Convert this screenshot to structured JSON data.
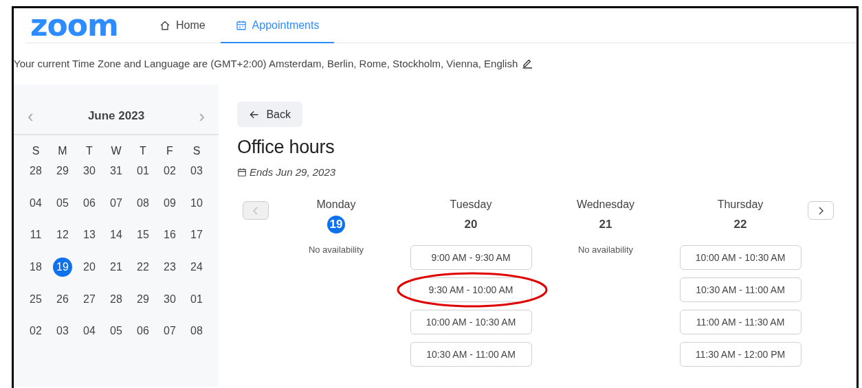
{
  "logo": "zoom",
  "nav": [
    {
      "label": "Home",
      "kind": "home",
      "selected": false
    },
    {
      "label": "Appointments",
      "kind": "calendar",
      "selected": true
    }
  ],
  "timezone_text": "Your current Time Zone and Language are (GMT+2:00) Amsterdam, Berlin, Rome, Stockholm, Vienna, English",
  "calendar": {
    "month": "June 2023",
    "prev": "‹",
    "next": "›",
    "weekdays": [
      "S",
      "M",
      "T",
      "W",
      "T",
      "F",
      "S"
    ],
    "weeks": [
      [
        {
          "day": "28",
          "selected": false
        },
        {
          "day": "29",
          "selected": false
        },
        {
          "day": "30",
          "selected": false
        },
        {
          "day": "31",
          "selected": false
        },
        {
          "day": "01",
          "selected": false
        },
        {
          "day": "02",
          "selected": false
        },
        {
          "day": "03",
          "selected": false
        }
      ],
      [
        {
          "day": "04",
          "selected": false
        },
        {
          "day": "05",
          "selected": false
        },
        {
          "day": "06",
          "selected": false
        },
        {
          "day": "07",
          "selected": false
        },
        {
          "day": "08",
          "selected": false
        },
        {
          "day": "09",
          "selected": false
        },
        {
          "day": "10",
          "selected": false
        }
      ],
      [
        {
          "day": "11",
          "selected": false
        },
        {
          "day": "12",
          "selected": false
        },
        {
          "day": "13",
          "selected": false
        },
        {
          "day": "14",
          "selected": false
        },
        {
          "day": "15",
          "selected": false
        },
        {
          "day": "16",
          "selected": false
        },
        {
          "day": "17",
          "selected": false
        }
      ],
      [
        {
          "day": "18",
          "selected": false
        },
        {
          "day": "19",
          "selected": true
        },
        {
          "day": "20",
          "selected": false
        },
        {
          "day": "21",
          "selected": false
        },
        {
          "day": "22",
          "selected": false
        },
        {
          "day": "23",
          "selected": false
        },
        {
          "day": "24",
          "selected": false
        }
      ],
      [
        {
          "day": "25",
          "selected": false
        },
        {
          "day": "26",
          "selected": false
        },
        {
          "day": "27",
          "selected": false
        },
        {
          "day": "28",
          "selected": false
        },
        {
          "day": "29",
          "selected": false
        },
        {
          "day": "30",
          "selected": false
        },
        {
          "day": "01",
          "selected": false
        }
      ],
      [
        {
          "day": "02",
          "selected": false
        },
        {
          "day": "03",
          "selected": false
        },
        {
          "day": "04",
          "selected": false
        },
        {
          "day": "05",
          "selected": false
        },
        {
          "day": "06",
          "selected": false
        },
        {
          "day": "07",
          "selected": false
        },
        {
          "day": "08",
          "selected": false
        }
      ]
    ]
  },
  "back_button": "Back",
  "title": "Office hours",
  "ends": "Ends Jun 29, 2023",
  "prev_week_disabled": true,
  "next_week_disabled": false,
  "days": [
    {
      "name": "Monday",
      "date": "19",
      "selected": true,
      "no_availability": "No availability"
    },
    {
      "name": "Tuesday",
      "date": "20",
      "selected": false,
      "slots": [
        {
          "time": "9:00 AM - 9:30 AM",
          "circled": false
        },
        {
          "time": "9:30 AM - 10:00 AM",
          "circled": true
        },
        {
          "time": "10:00 AM - 10:30 AM",
          "circled": false
        },
        {
          "time": "10:30 AM - 11:00 AM",
          "circled": false
        }
      ]
    },
    {
      "name": "Wednesday",
      "date": "21",
      "selected": false,
      "no_availability": "No availability"
    },
    {
      "name": "Thursday",
      "date": "22",
      "selected": false,
      "slots": [
        {
          "time": "10:00 AM - 10:30 AM",
          "circled": false
        },
        {
          "time": "10:30 AM - 11:00 AM",
          "circled": false
        },
        {
          "time": "11:00 AM - 11:30 AM",
          "circled": false
        },
        {
          "time": "11:30 AM - 12:00 PM",
          "circled": false
        }
      ]
    }
  ]
}
